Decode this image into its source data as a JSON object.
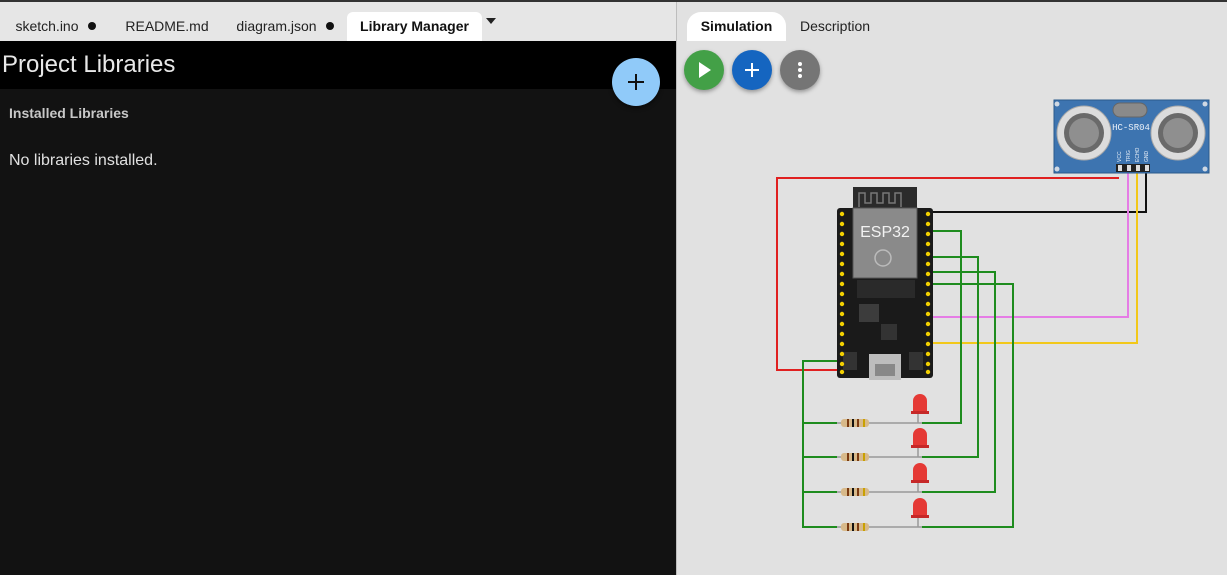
{
  "editor": {
    "tabs": [
      {
        "label": "sketch.ino",
        "modified": true
      },
      {
        "label": "README.md",
        "modified": false
      },
      {
        "label": "diagram.json",
        "modified": true
      },
      {
        "label": "Library Manager",
        "modified": false,
        "active": true
      }
    ]
  },
  "library_manager": {
    "title": "Project Libraries",
    "section_label": "Installed Libraries",
    "empty_message": "No libraries installed."
  },
  "simulation": {
    "tabs": [
      {
        "label": "Simulation",
        "active": true
      },
      {
        "label": "Description",
        "active": false
      }
    ],
    "controls": {
      "play_icon": "play-icon",
      "add_icon": "plus-icon",
      "more_icon": "more-vertical-icon"
    },
    "components": {
      "mcu_label": "ESP32",
      "sensor_label": "HC-SR04",
      "sensor_pins": [
        "VCC",
        "TRIG",
        "ECHO",
        "GND"
      ]
    },
    "wire_colors": {
      "vcc": "#e02020",
      "gnd": "#111111",
      "trig": "#e57ce5",
      "echo": "#f2c81a",
      "led": "#1e8c1e"
    }
  }
}
